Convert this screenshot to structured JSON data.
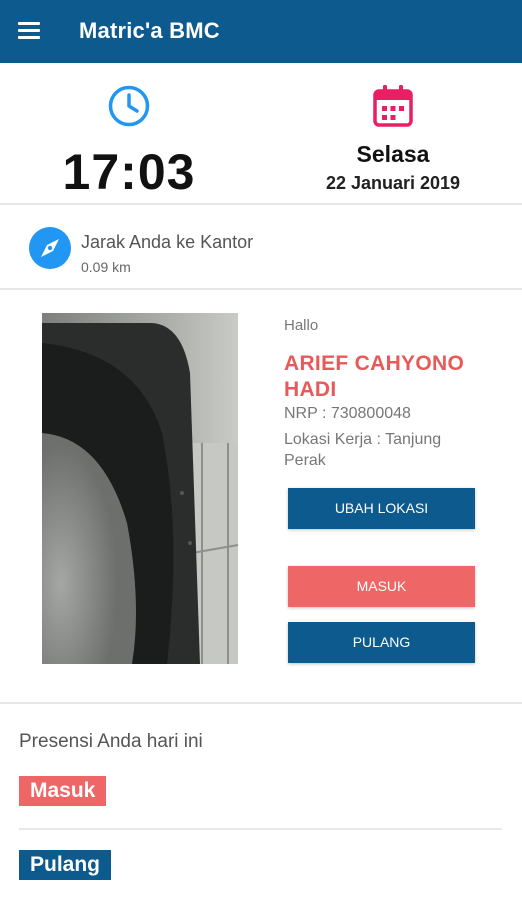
{
  "appbar": {
    "title": "Matric'a BMC",
    "menu_icon": "hamburger-menu-icon",
    "color": "#0d5a8e"
  },
  "clock": {
    "icon": "clock-icon",
    "time": "17:03"
  },
  "calendar": {
    "icon": "calendar-icon",
    "day": "Selasa",
    "date": "22 Januari 2019"
  },
  "distance": {
    "icon": "compass-icon",
    "label": "Jarak Anda ke Kantor",
    "value": "0.09 km"
  },
  "profile": {
    "greeting": "Hallo",
    "name": "ARIEF CAHYONO HADI",
    "nrp": "NRP : 730800048",
    "lokasi": "Lokasi Kerja : Tanjung Perak"
  },
  "buttons": {
    "ubah_lokasi": "UBAH LOKASI",
    "masuk": "MASUK",
    "pulang": "PULANG"
  },
  "presensi": {
    "title": "Presensi Anda hari ini",
    "masuk": "Masuk",
    "pulang": "Pulang"
  },
  "colors": {
    "primary": "#0d5a8e",
    "accent": "#ee6666",
    "name": "#e85a5a"
  }
}
